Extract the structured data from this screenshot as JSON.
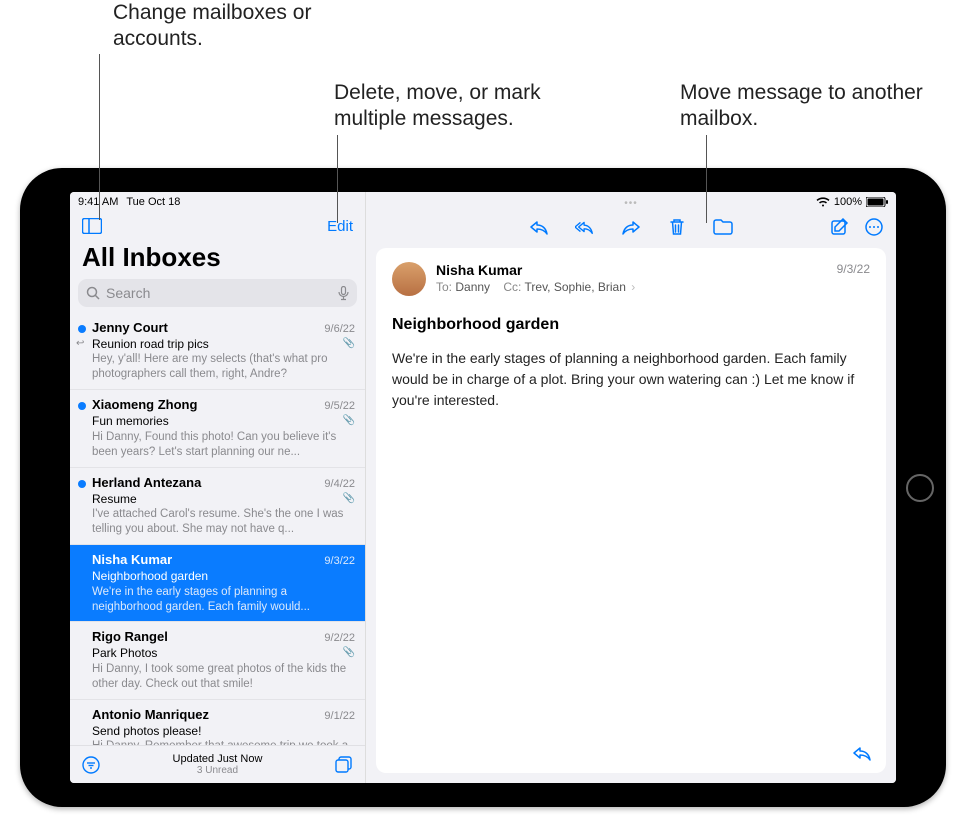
{
  "callouts": {
    "c1": "Change mailboxes or accounts.",
    "c2": "Delete, move, or mark multiple messages.",
    "c3": "Move message to another mailbox."
  },
  "statusbar": {
    "time": "9:41 AM",
    "date": "Tue Oct 18",
    "battery": "100%"
  },
  "sidebar": {
    "edit": "Edit",
    "title": "All Inboxes",
    "search_placeholder": "Search",
    "bottom": {
      "updated": "Updated Just Now",
      "unread": "3 Unread"
    }
  },
  "messages": [
    {
      "sender": "Jenny Court",
      "date": "9/6/22",
      "subject": "Reunion road trip pics",
      "preview": "Hey, y'all! Here are my selects (that's what pro photographers call them, right, Andre?",
      "unread": true,
      "replied": true,
      "attachment": true
    },
    {
      "sender": "Xiaomeng Zhong",
      "date": "9/5/22",
      "subject": "Fun memories",
      "preview": "Hi Danny, Found this photo! Can you believe it's been years? Let's start planning our ne...",
      "unread": true,
      "attachment": true
    },
    {
      "sender": "Herland Antezana",
      "date": "9/4/22",
      "subject": "Resume",
      "preview": "I've attached Carol's resume. She's the one I was telling you about. She may not have q...",
      "unread": true,
      "attachment": true
    },
    {
      "sender": "Nisha Kumar",
      "date": "9/3/22",
      "subject": "Neighborhood garden",
      "preview": "We're in the early stages of planning a neighborhood garden. Each family would...",
      "selected": true
    },
    {
      "sender": "Rigo Rangel",
      "date": "9/2/22",
      "subject": "Park Photos",
      "preview": "Hi Danny, I took some great photos of the kids the other day. Check out that smile!",
      "attachment": true
    },
    {
      "sender": "Antonio Manriquez",
      "date": "9/1/22",
      "subject": "Send photos please!",
      "preview": "Hi Danny, Remember that awesome trip we took a few years ago? I found this picture,..."
    }
  ],
  "open_message": {
    "from": "Nisha Kumar",
    "to_label": "To:",
    "to": "Danny",
    "cc_label": "Cc:",
    "cc": "Trev, Sophie, Brian",
    "date": "9/3/22",
    "subject": "Neighborhood garden",
    "body": "We're in the early stages of planning a neighborhood garden. Each family would be in charge of a plot. Bring your own watering can :) Let me know if you're interested."
  }
}
